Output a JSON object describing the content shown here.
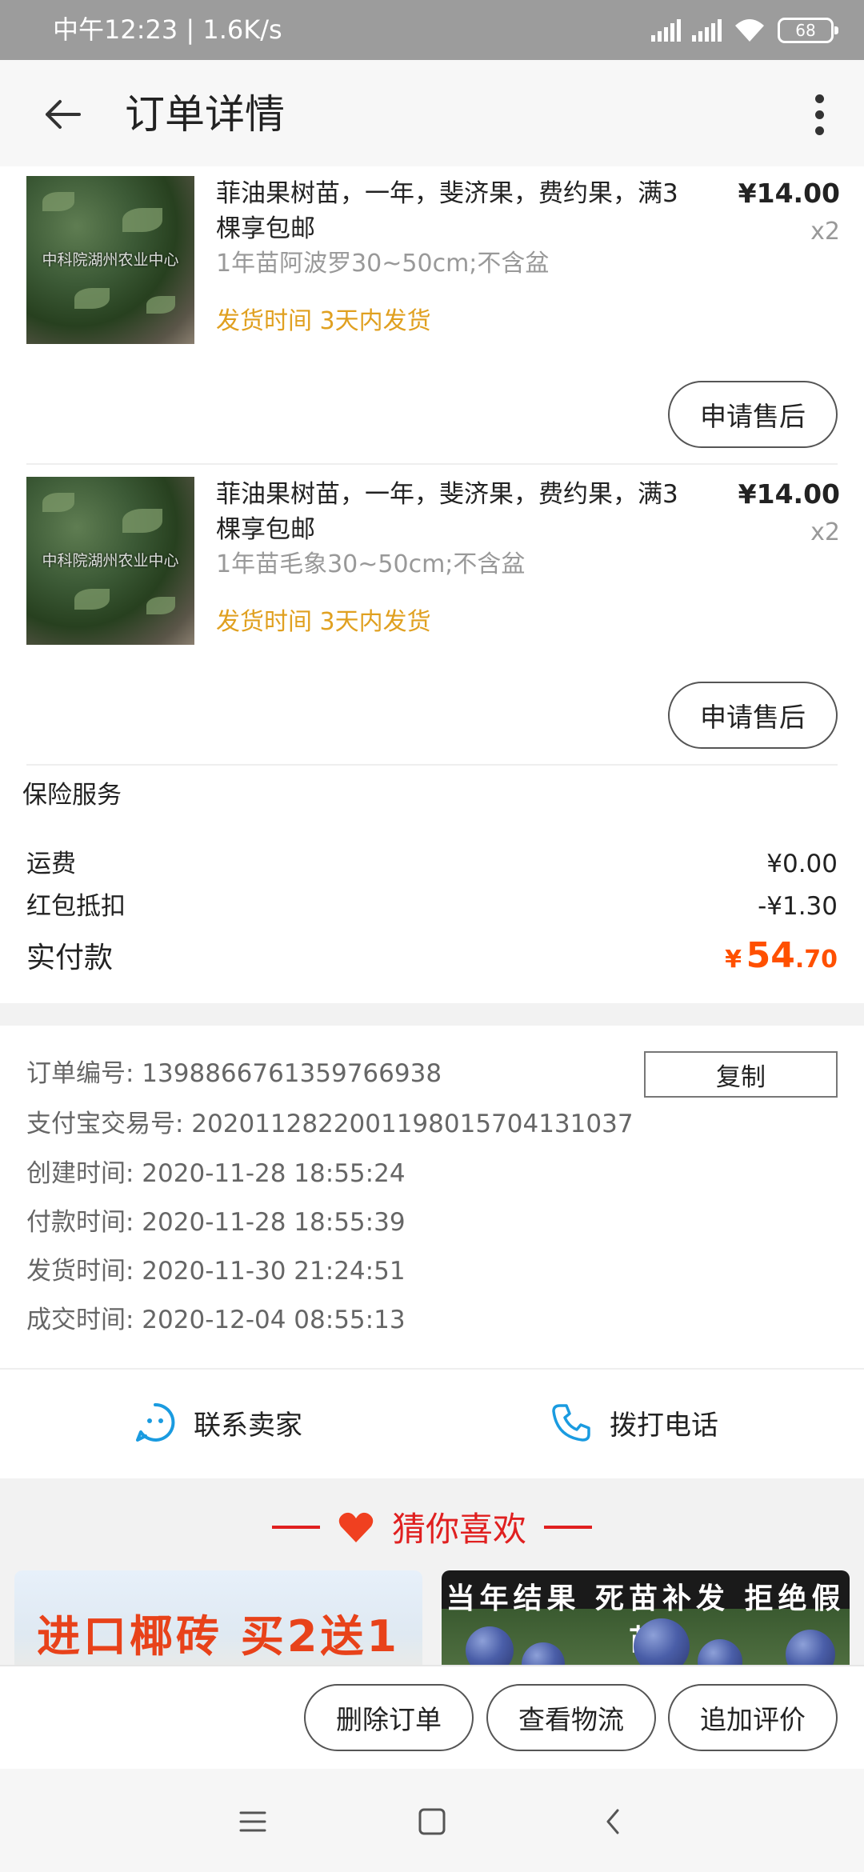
{
  "status_bar": {
    "time_text": "中午12:23 | 1.6K/s",
    "battery": "68"
  },
  "header": {
    "title": "订单详情",
    "back_icon": "back-arrow-icon",
    "more_icon": "more-vertical-icon"
  },
  "products": [
    {
      "name": "菲油果树苗，一年，斐济果，费约果，满3棵享包邮",
      "sku": "1年苗阿波罗30~50cm;不含盆",
      "ship_label": "发货时间",
      "ship_value": "3天内发货",
      "price": "¥14.00",
      "qty": "x2",
      "after_sale": "申请售后",
      "watermark": "中科院湖州农业中心"
    },
    {
      "name": "菲油果树苗，一年，斐济果，费约果，满3棵享包邮",
      "sku": "1年苗毛象30~50cm;不含盆",
      "ship_label": "发货时间",
      "ship_value": "3天内发货",
      "price": "¥14.00",
      "qty": "x2",
      "after_sale": "申请售后",
      "watermark": "中科院湖州农业中心"
    }
  ],
  "summary": {
    "insurance_label": "保险服务",
    "freight_label": "运费",
    "freight_value": "¥0.00",
    "coupon_label": "红包抵扣",
    "coupon_value": "-¥1.30",
    "total_label": "实付款",
    "total_currency": "¥",
    "total_integer": "54",
    "total_decimal": ".70",
    "accent_color": "#ff5000"
  },
  "order_info": {
    "order_no": "订单编号: 1398866761359766938",
    "copy_label": "复制",
    "alipay_no": "支付宝交易号: 2020112822001198015704131037",
    "created": "创建时间: 2020-11-28 18:55:24",
    "paid": "付款时间: 2020-11-28 18:55:39",
    "shipped": "发货时间: 2020-11-30 21:24:51",
    "completed": "成交时间: 2020-12-04 08:55:13"
  },
  "contact": {
    "seller_label": "联系卖家",
    "call_label": "拨打电话",
    "icon_color": "#1a9be0"
  },
  "recommend": {
    "title": "猜你喜欢",
    "card_left_text": "进口椰砖 买2送1",
    "card_right_text": "当年结果 死苗补发 拒绝假苗"
  },
  "actions": {
    "delete": "删除订单",
    "logistics": "查看物流",
    "review": "追加评价"
  }
}
